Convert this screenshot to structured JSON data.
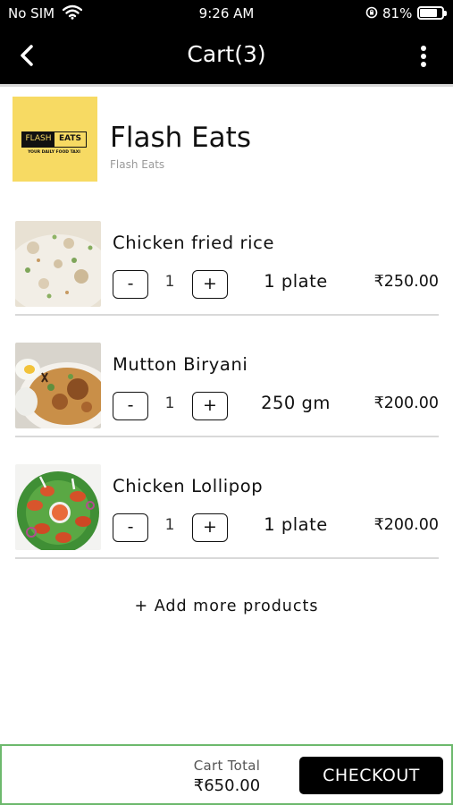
{
  "status_bar": {
    "carrier": "No SIM",
    "time": "9:26 AM",
    "battery_percent": "81%",
    "battery_level": 0.81
  },
  "nav": {
    "title": "Cart(3)",
    "back_icon": "chevron-left-icon",
    "menu_icon": "more-vertical-icon"
  },
  "store": {
    "name": "Flash Eats",
    "subtitle": "Flash Eats",
    "logo": {
      "word_a": "FLASH",
      "word_b": "EATS",
      "tagline": "YOUR DAILY FOOD TAXI",
      "background": "#f7da63"
    }
  },
  "items": [
    {
      "name": "Chicken fried rice",
      "minus": "-",
      "quantity": "1",
      "plus": "+",
      "unit": "1 plate",
      "price": "₹250.00",
      "image": "fried-rice-photo"
    },
    {
      "name": "Mutton Biryani",
      "minus": "-",
      "quantity": "1",
      "plus": "+",
      "unit": "250 gm",
      "price": "₹200.00",
      "image": "biryani-photo"
    },
    {
      "name": "Chicken Lollipop",
      "minus": "-",
      "quantity": "1",
      "plus": "+",
      "unit": "1 plate",
      "price": "₹200.00",
      "image": "chicken-lollipop-photo"
    }
  ],
  "add_more": "+ Add more products",
  "footer": {
    "total_label": "Cart Total",
    "total_value": "₹650.00",
    "checkout_label": "CHECKOUT",
    "border_color": "#6db96d"
  }
}
